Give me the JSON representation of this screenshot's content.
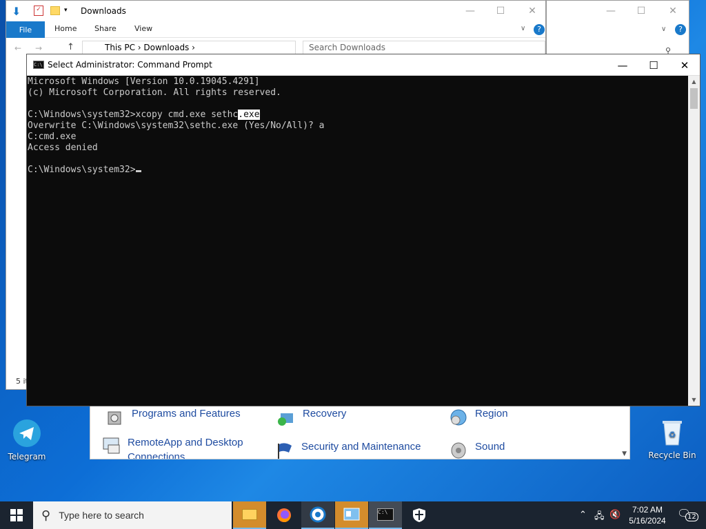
{
  "desktop": {
    "icons": [
      {
        "label": "Telegram"
      },
      {
        "label": "Recycle Bin"
      }
    ]
  },
  "explorer_back": {
    "title": "Downloads",
    "ribbon_tabs": [
      "File",
      "Home",
      "Share",
      "View"
    ],
    "breadcrumb": [
      "This PC",
      "Downloads"
    ],
    "search_placeholder": "Search Downloads",
    "status": "5 it"
  },
  "control_panel": {
    "items": [
      {
        "label": "Programs and Features"
      },
      {
        "label": "Recovery"
      },
      {
        "label": "Region"
      },
      {
        "label": "RemoteApp and Desktop Connections"
      },
      {
        "label": "Security and Maintenance"
      },
      {
        "label": "Sound"
      }
    ]
  },
  "cmd": {
    "title": "Select Administrator: Command Prompt",
    "lines": [
      "Microsoft Windows [Version 10.0.19045.4291]",
      "(c) Microsoft Corporation. All rights reserved.",
      "",
      "C:\\Windows\\system32>xcopy cmd.exe sethc.exe",
      "Overwrite C:\\Windows\\system32\\sethc.exe (Yes/No/All)? a",
      "C:cmd.exe",
      "Access denied",
      "",
      "C:\\Windows\\system32>"
    ],
    "selected_text": ".exe",
    "cmd_prefix": "C:\\Windows\\system32>xcopy cmd.exe sethc"
  },
  "taskbar": {
    "search_placeholder": "Type here to search",
    "time": "7:02 AM",
    "date": "5/16/2024",
    "notification_count": "12"
  },
  "colors": {
    "console_bg": "#0c0c0c",
    "console_fg": "#cccccc",
    "accent": "#1979ca",
    "taskbar": "#1b2430"
  }
}
